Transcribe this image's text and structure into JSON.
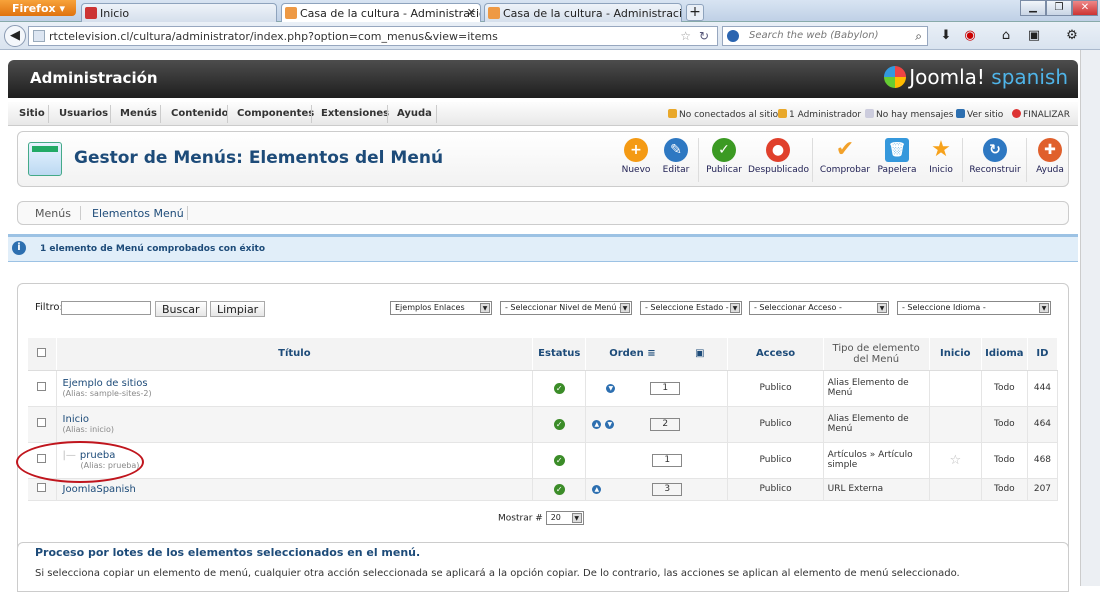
{
  "browser": {
    "firefox_label": "Firefox",
    "tabs": [
      {
        "label": "Inicio"
      },
      {
        "label": "Casa de la cultura - Administración - ..."
      },
      {
        "label": "Casa de la cultura - Administración - Ge..."
      }
    ],
    "url": "rtctelevision.cl/cultura/administrator/index.php?option=com_menus&view=items",
    "search_placeholder": "Search the web (Babylon)"
  },
  "header": {
    "title": "Administración",
    "logo_text": "Joomla!",
    "logo_suffix": "spanish"
  },
  "menu": {
    "items": [
      "Sitio",
      "Usuarios",
      "Menús",
      "Contenido",
      "Componentes",
      "Extensiones",
      "Ayuda"
    ]
  },
  "status": {
    "no_conectados": "No conectados al sitio",
    "administrador": "1 Administrador",
    "mensajes": "No hay mensajes",
    "ver_sitio": "Ver sitio",
    "finalizar": "FINALIZAR"
  },
  "toolbar": {
    "title": "Gestor de Menús: Elementos del Menú",
    "buttons": [
      "Nuevo",
      "Editar",
      "Publicar",
      "Despublicado",
      "Comprobar",
      "Papelera",
      "Inicio",
      "Reconstruir",
      "Ayuda"
    ],
    "colors": [
      "#f49a14",
      "#2e78c2",
      "#3b9a23",
      "#e0402c",
      "#f2a12a",
      "#3598dc",
      "#f7a21b",
      "#2e78c2",
      "#e0602c"
    ]
  },
  "subtabs": [
    "Menús",
    "Elementos Menú"
  ],
  "message": "1 elemento de Menú comprobados con éxito",
  "filter": {
    "label": "Filtro:",
    "search_button": "Buscar",
    "clear_button": "Limpiar",
    "selects": [
      "Ejemplos Enlaces",
      "- Seleccionar Nivel de Menú -",
      "- Seleccione Estado -",
      "- Seleccionar Acceso -",
      "- Seleccione Idioma -"
    ]
  },
  "table": {
    "headers": {
      "titulo": "Título",
      "estatus": "Estatus",
      "orden": "Orden",
      "acceso": "Acceso",
      "tipo": "Tipo de elemento del Menú",
      "inicio": "Inicio",
      "idioma": "Idioma",
      "id": "ID"
    },
    "rows": [
      {
        "title": "Ejemplo de sitios",
        "alias": "(Alias: sample-sites-2)",
        "order": "1",
        "access": "Publico",
        "type": "Alias Elemento de Menú",
        "lang": "Todo",
        "id": "444"
      },
      {
        "title": "Inicio",
        "alias": "(Alias: inicio)",
        "order": "2",
        "access": "Publico",
        "type": "Alias Elemento de Menú",
        "lang": "Todo",
        "id": "464"
      },
      {
        "title": "prueba",
        "alias": "(Alias: prueba)",
        "order": "1",
        "access": "Publico",
        "type": "Artículos » Artículo simple",
        "lang": "Todo",
        "id": "468"
      },
      {
        "title": "JoomlaSpanish",
        "alias": "",
        "order": "3",
        "access": "Publico",
        "type": "URL Externa",
        "lang": "Todo",
        "id": "207"
      }
    ]
  },
  "pagination": {
    "label": "Mostrar #",
    "value": "20"
  },
  "batch": {
    "title": "Proceso por lotes de los elementos seleccionados en el menú.",
    "desc": "Si selecciona copiar un elemento de menú, cualquier otra acción seleccionada se aplicará a la opción copiar. De lo contrario, las acciones se aplican al elemento de menú seleccionado."
  }
}
